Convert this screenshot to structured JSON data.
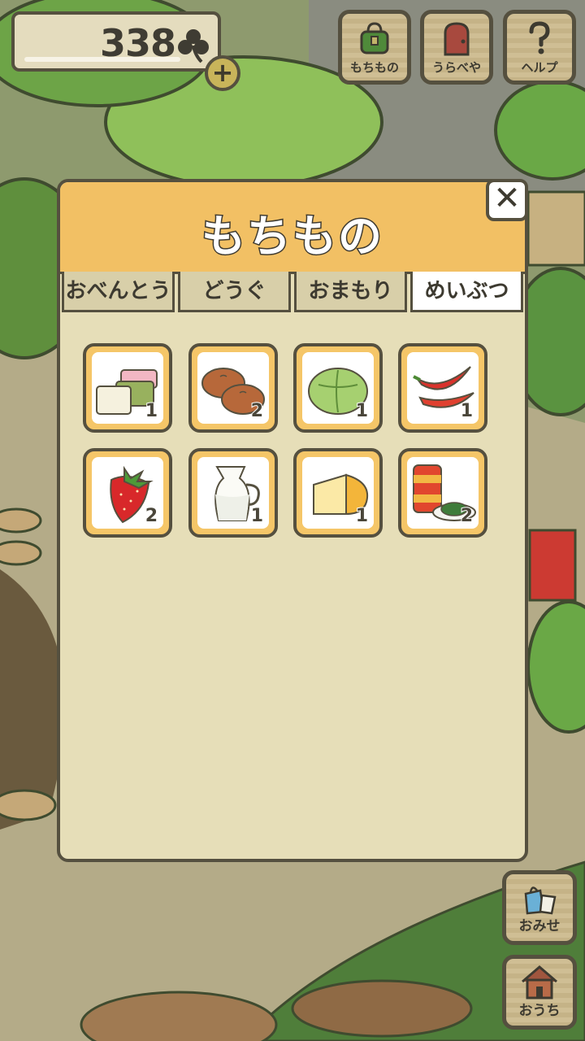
{
  "hud": {
    "clover_count": "338",
    "clover_icon": "clover-icon",
    "add_label": "+"
  },
  "top_buttons": [
    {
      "label": "もちもの",
      "icon": "bag-icon"
    },
    {
      "label": "うらべや",
      "icon": "door-icon"
    },
    {
      "label": "ヘルプ",
      "icon": "question-icon"
    }
  ],
  "modal": {
    "title": "もちもの",
    "close_label": "✕",
    "tabs": [
      {
        "label": "おべんとう",
        "active": false
      },
      {
        "label": "どうぐ",
        "active": false
      },
      {
        "label": "おまもり",
        "active": false
      },
      {
        "label": "めいぶつ",
        "active": true
      }
    ],
    "items": [
      {
        "icon": "tofu-mochi-icon",
        "qty": "1"
      },
      {
        "icon": "manju-buns-icon",
        "qty": "2"
      },
      {
        "icon": "cabbage-icon",
        "qty": "1"
      },
      {
        "icon": "red-peppers-icon",
        "qty": "1"
      },
      {
        "icon": "strawberry-icon",
        "qty": "2"
      },
      {
        "icon": "milk-jug-icon",
        "qty": "1"
      },
      {
        "icon": "cheese-icon",
        "qty": "1"
      },
      {
        "icon": "tea-can-icon",
        "qty": "2"
      }
    ]
  },
  "side_buttons": [
    {
      "label": "おみせ",
      "icon": "shop-bags-icon"
    },
    {
      "label": "おうち",
      "icon": "house-icon"
    }
  ],
  "colors": {
    "header_yellow": "#f2c064",
    "panel_bg": "#e6deb8",
    "outline": "#55503f"
  }
}
